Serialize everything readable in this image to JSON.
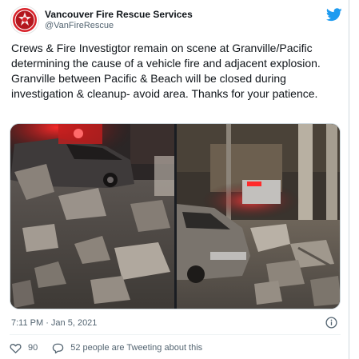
{
  "tweet": {
    "display_name": "Vancouver Fire Rescue Services",
    "handle": "@VanFireRescue",
    "text": "Crews & Fire Investigtor remain on scene at Granville/Pacific determining the cause of a vehicle fire and adjacent explosion. Granville between Pacific & Beach will be closed during investigation & cleanup- avoid area. Thanks for your patience.",
    "timestamp": "7:11 PM · Jan 5, 2021",
    "likes": "90",
    "tweeting_text": "52 people are Tweeting about this"
  },
  "icons": {
    "avatar": "fire-rescue-logo",
    "platform": "twitter-bird-icon",
    "info": "info-icon",
    "like": "heart-icon",
    "reply": "speech-bubble-icon"
  },
  "colors": {
    "brand_blue": "#1d9bf0",
    "avatar_red": "#d82129",
    "secondary_text": "#536471"
  }
}
